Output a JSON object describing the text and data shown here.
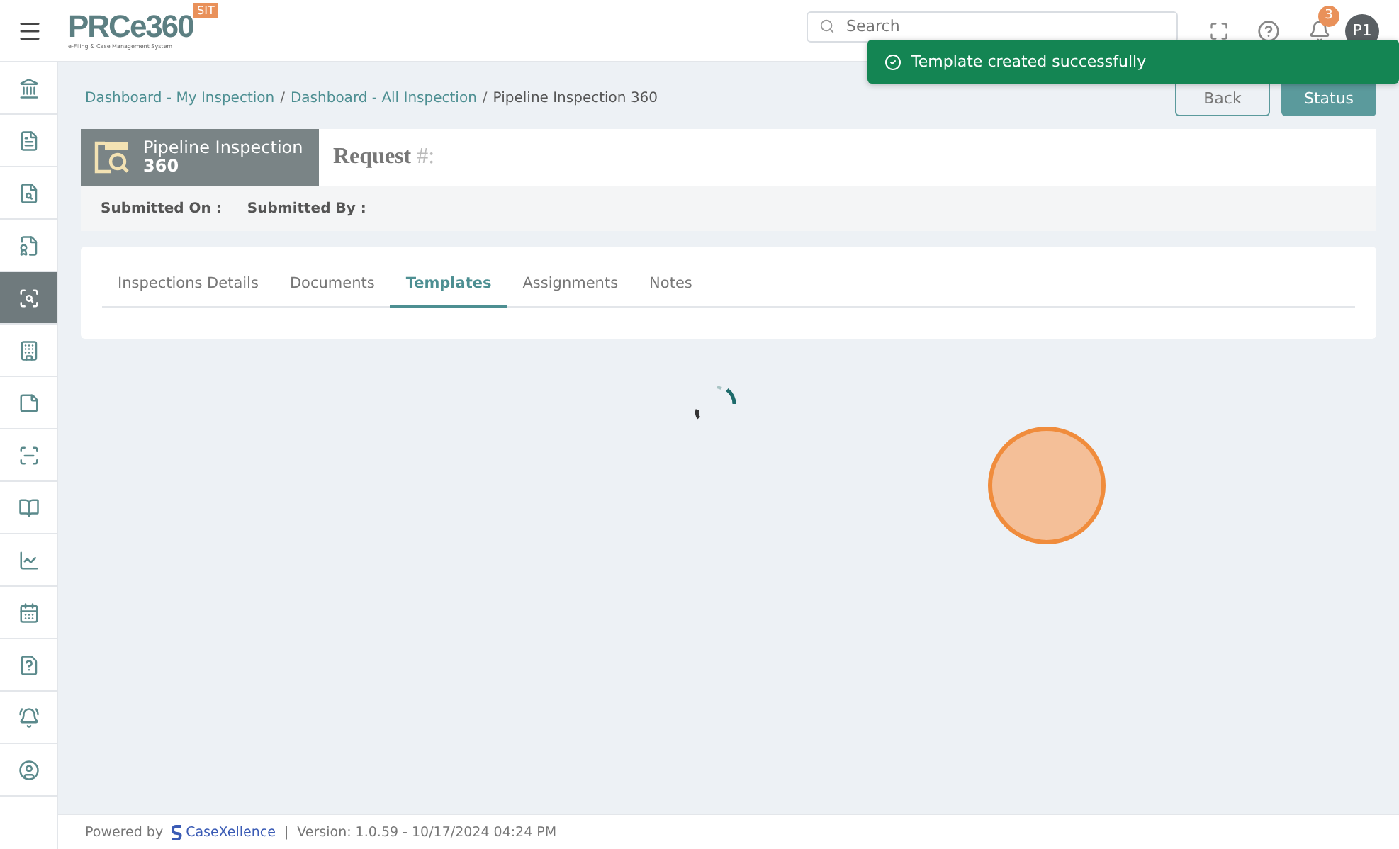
{
  "header": {
    "logo": {
      "brand": "PRCe360",
      "tagline": "e-Filing & Case Management System",
      "badge": "SIT"
    },
    "search": {
      "placeholder": "Search"
    },
    "notifications": {
      "count": "3"
    },
    "avatar": "P1"
  },
  "toast": {
    "message": "Template created successfully"
  },
  "sidebar": {
    "items": [
      {
        "selected": false
      },
      {
        "selected": false
      },
      {
        "selected": false
      },
      {
        "selected": false
      },
      {
        "selected": true
      },
      {
        "selected": false
      },
      {
        "selected": false
      },
      {
        "selected": false
      },
      {
        "selected": false
      },
      {
        "selected": false
      },
      {
        "selected": false
      },
      {
        "selected": false
      },
      {
        "selected": false
      },
      {
        "selected": false
      }
    ]
  },
  "breadcrumb": [
    {
      "label": "Dashboard - My Inspection",
      "separator": "/"
    },
    {
      "label": "Dashboard - All Inspection",
      "separator": "/"
    },
    {
      "label": "Pipeline Inspection 360"
    }
  ],
  "actions": [
    "Back",
    "Status"
  ],
  "record": {
    "type_line1": "Pipeline Inspection",
    "type_line2": "360",
    "request_label": "Request",
    "request_hash": "#:",
    "submitted_on": "Submitted On :",
    "submitted_by": "Submitted By :"
  },
  "tabs": [
    {
      "label": "Inspections Details",
      "selected": false
    },
    {
      "label": "Documents",
      "selected": false
    },
    {
      "label": "Templates",
      "selected": true
    },
    {
      "label": "Assignments",
      "selected": false
    },
    {
      "label": "Notes",
      "selected": false
    }
  ],
  "footer": {
    "powered_by": "Powered by",
    "brand": "CaseXellence",
    "separator": "|",
    "version": "Version: 1.0.59 - 10/17/2024 04:24 PM"
  }
}
